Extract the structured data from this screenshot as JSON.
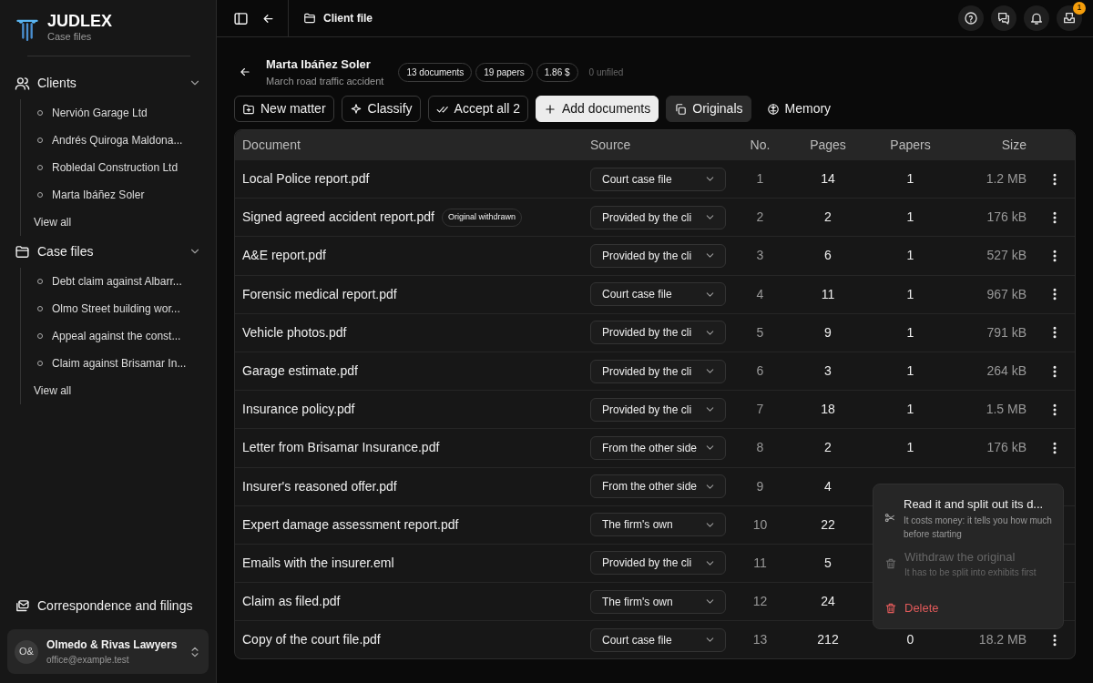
{
  "sidebar": {
    "brand": {
      "title": "JUDLEX",
      "subtitle": "Case files"
    },
    "sections": [
      {
        "kind": "clients",
        "label": "Clients",
        "expanded": true,
        "items": [
          "Nervión Garage Ltd",
          "Andrés Quiroga Maldona...",
          "Robledal Construction Ltd",
          "Marta Ibáñez Soler"
        ],
        "view_all": "View all"
      },
      {
        "kind": "cases",
        "label": "Case files",
        "expanded": true,
        "items": [
          "Debt claim against Albarr...",
          "Olmo Street building wor...",
          "Appeal against the const...",
          "Claim against Brisamar In..."
        ],
        "view_all": "View all"
      }
    ],
    "footer_link": "Correspondence and filings",
    "account": {
      "initials": "O&",
      "name": "Olmedo & Rivas Lawyers",
      "email": "office@example.test"
    }
  },
  "topbar": {
    "breadcrumb": "Client file",
    "badge": "1"
  },
  "header": {
    "title": "Marta Ibáñez Soler",
    "subtitle": "March road traffic accident",
    "chips": [
      "13 documents",
      "19 papers",
      "1.86 $"
    ],
    "unfiled": "0 unfiled"
  },
  "toolbar": [
    {
      "label": "New matter",
      "kind": "outline"
    },
    {
      "label": "Classify",
      "kind": "outline"
    },
    {
      "label": "Accept all 2",
      "kind": "outline"
    },
    {
      "label": "Add documents",
      "kind": "primary"
    },
    {
      "label": "Originals",
      "kind": "filled"
    },
    {
      "label": "Memory",
      "kind": "plain"
    }
  ],
  "table": {
    "columns": [
      "Document",
      "Source",
      "No.",
      "Pages",
      "Papers",
      "Size"
    ],
    "rows": [
      {
        "document": "Local Police report.pdf",
        "source": "Court case file",
        "no": "1",
        "pages": "14",
        "papers": "1",
        "size": "1.2 MB"
      },
      {
        "document": "Signed agreed accident report.pdf",
        "tag": "Original withdrawn",
        "source": "Provided by the cli",
        "no": "2",
        "pages": "2",
        "papers": "1",
        "size": "176 kB"
      },
      {
        "document": "A&E report.pdf",
        "source": "Provided by the cli",
        "no": "3",
        "pages": "6",
        "papers": "1",
        "size": "527 kB"
      },
      {
        "document": "Forensic medical report.pdf",
        "source": "Court case file",
        "no": "4",
        "pages": "11",
        "papers": "1",
        "size": "967 kB"
      },
      {
        "document": "Vehicle photos.pdf",
        "source": "Provided by the cli",
        "no": "5",
        "pages": "9",
        "papers": "1",
        "size": "791 kB"
      },
      {
        "document": "Garage estimate.pdf",
        "source": "Provided by the cli",
        "no": "6",
        "pages": "3",
        "papers": "1",
        "size": "264 kB"
      },
      {
        "document": "Insurance policy.pdf",
        "source": "Provided by the cli",
        "no": "7",
        "pages": "18",
        "papers": "1",
        "size": "1.5 MB"
      },
      {
        "document": "Letter from Brisamar Insurance.pdf",
        "source": "From the other side",
        "no": "8",
        "pages": "2",
        "papers": "1",
        "size": "176 kB"
      },
      {
        "document": "Insurer's reasoned offer.pdf",
        "source": "From the other side",
        "no": "9",
        "pages": "4"
      },
      {
        "document": "Expert damage assessment report.pdf",
        "source": "The firm's own",
        "no": "10",
        "pages": "22"
      },
      {
        "document": "Emails with the insurer.eml",
        "source": "Provided by the cli",
        "no": "11",
        "pages": "5"
      },
      {
        "document": "Claim as filed.pdf",
        "source": "The firm's own",
        "no": "12",
        "pages": "24"
      },
      {
        "document": "Copy of the court file.pdf",
        "source": "Court case file",
        "no": "13",
        "pages": "212",
        "papers": "0",
        "size": "18.2 MB"
      }
    ]
  },
  "menu": {
    "items": [
      {
        "kind": "split",
        "label": "Read it and split out its d...",
        "hint": "It costs money: it tells you how much before starting",
        "disabled": false
      },
      {
        "kind": "withdraw",
        "label": "Withdraw the original",
        "hint": "It has to be split into exhibits first",
        "disabled": true
      },
      {
        "kind": "delete",
        "label": "Delete",
        "disabled": false
      }
    ]
  }
}
